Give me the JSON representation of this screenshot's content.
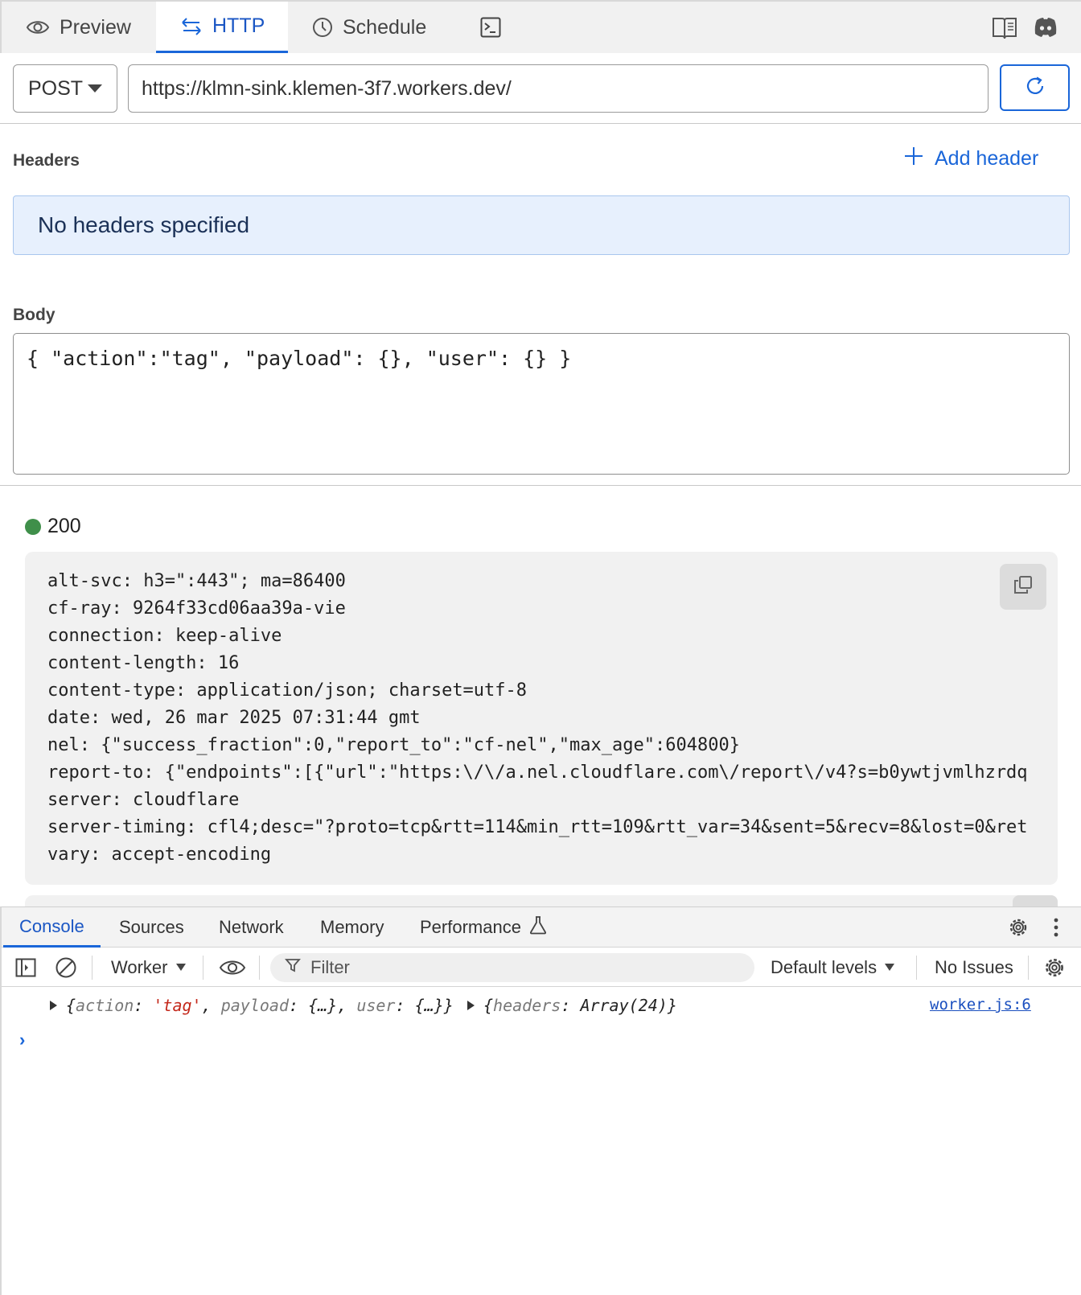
{
  "tabs": [
    {
      "label": "Preview",
      "icon": "eye-icon"
    },
    {
      "label": "HTTP",
      "icon": "arrows-swap-icon",
      "active": true
    },
    {
      "label": "Schedule",
      "icon": "clock-icon"
    },
    {
      "label": "",
      "icon": "terminal-icon"
    }
  ],
  "top_icons": [
    "book-icon",
    "discord-icon"
  ],
  "request": {
    "method": "POST",
    "url": "https://klmn-sink.klemen-3f7.workers.dev/"
  },
  "headers_section": {
    "label": "Headers",
    "add_label": "Add header",
    "empty_message": "No headers specified"
  },
  "body_section": {
    "label": "Body",
    "content": "{ \"action\":\"tag\", \"payload\": {}, \"user\": {} }"
  },
  "response": {
    "status_code": "200",
    "status_color": "#3f8f4a",
    "header_lines": [
      "alt-svc: h3=\":443\"; ma=86400",
      "cf-ray: 9264f33cd06aa39a-vie",
      "connection: keep-alive",
      "content-length: 16",
      "content-type: application/json; charset=utf-8",
      "date: wed, 26 mar 2025 07:31:44 gmt",
      "nel: {\"success_fraction\":0,\"report_to\":\"cf-nel\",\"max_age\":604800}",
      "report-to: {\"endpoints\":[{\"url\":\"https:\\/\\/a.nel.cloudflare.com\\/report\\/v4?s=b0ywtjvmlhzrdq",
      "server: cloudflare",
      "server-timing: cfl4;desc=\"?proto=tcp&rtt=114&min_rtt=109&rtt_var=34&sent=5&recv=8&lost=0&ret",
      "vary: accept-encoding"
    ]
  },
  "devtools": {
    "tabs": [
      "Console",
      "Sources",
      "Network",
      "Memory",
      "Performance"
    ],
    "active_tab": "Console",
    "context": "Worker",
    "filter_placeholder": "Filter",
    "levels": "Default levels",
    "issues": "No Issues",
    "log": {
      "obj1_k1": "action",
      "obj1_v1": "'tag'",
      "obj1_k2": "payload",
      "obj1_v2": "{…}",
      "obj1_k3": "user",
      "obj1_v3": "{…}",
      "obj2_k1": "headers",
      "obj2_v1": "Array(24)",
      "source": "worker.js:6"
    },
    "prompt": "›"
  },
  "colors": {
    "accent": "#1a66d9",
    "info_bg": "#e7f0fd",
    "code_bg": "#f1f1f1"
  }
}
